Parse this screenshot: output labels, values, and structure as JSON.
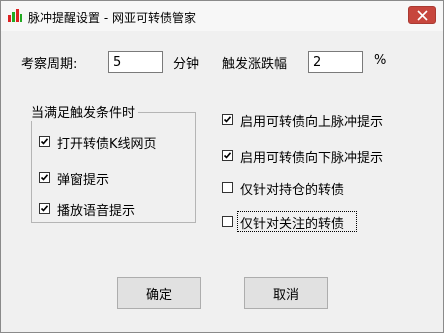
{
  "window": {
    "title": "脉冲提醒设置 - 网亚可转债管家",
    "icon": "app-bar-chart-icon",
    "close_icon": "close-icon"
  },
  "period": {
    "label": "考察周期:",
    "value": "5",
    "unit": "分钟"
  },
  "amplitude": {
    "label": "触发涨跌幅",
    "value": "2",
    "unit": "%"
  },
  "condition_group": {
    "title": "当满足触发条件时",
    "items": [
      {
        "label": "打开转债K线网页",
        "checked": true
      },
      {
        "label": "弹窗提示",
        "checked": true
      },
      {
        "label": "播放语音提示",
        "checked": true
      }
    ]
  },
  "options": [
    {
      "label": "启用可转债向上脉冲提示",
      "checked": true
    },
    {
      "label": "启用可转债向下脉冲提示",
      "checked": true
    },
    {
      "label": "仅针对持仓的转债",
      "checked": false
    },
    {
      "label": "仅针对关注的转债",
      "checked": false
    }
  ],
  "buttons": {
    "ok": "确定",
    "cancel": "取消"
  },
  "colors": {
    "close_button": "#c7463d",
    "window_bg": "#f0f0f0"
  }
}
